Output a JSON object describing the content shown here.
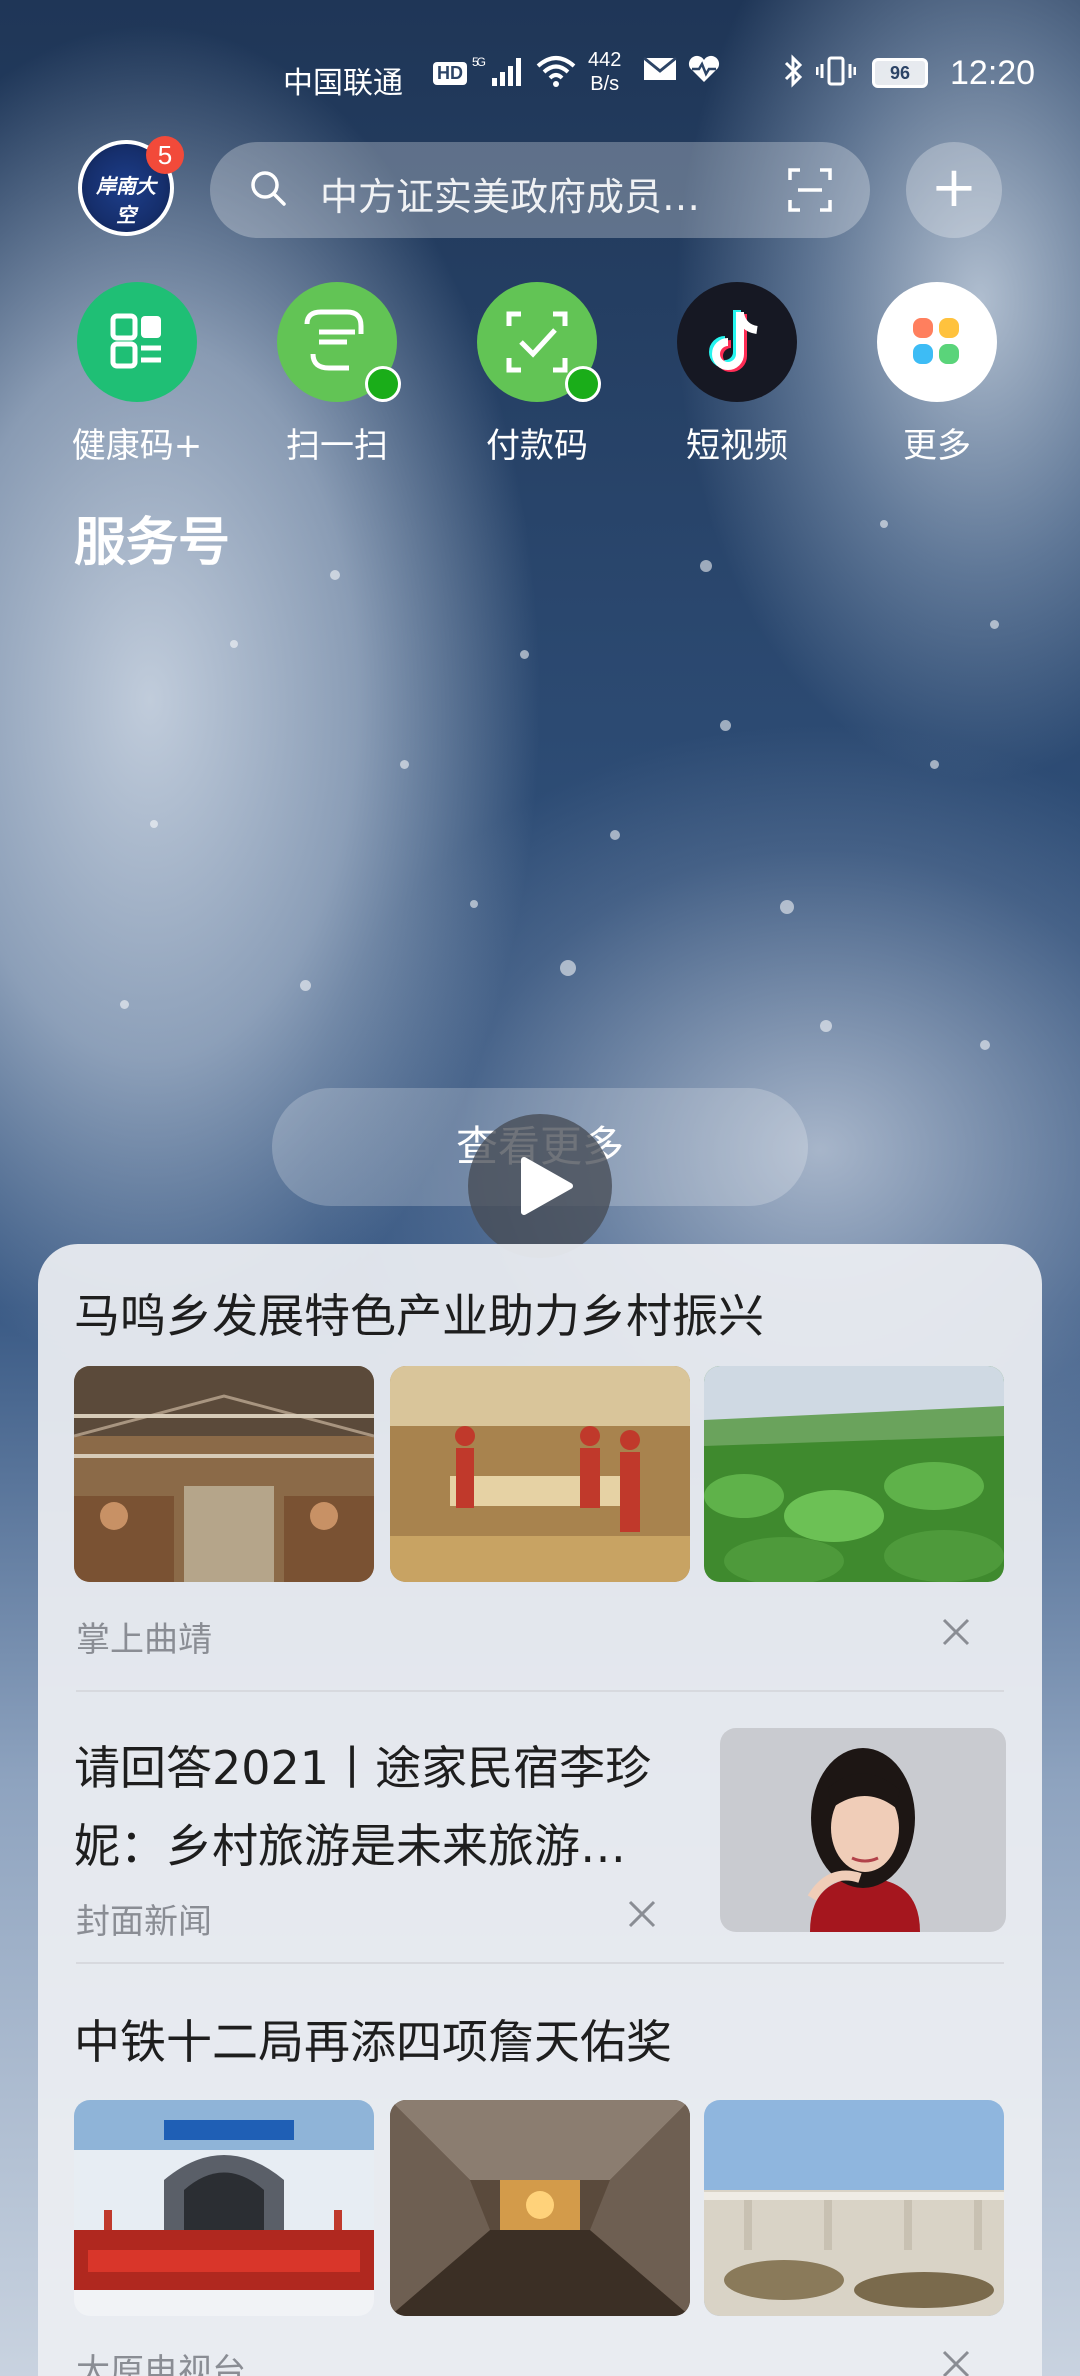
{
  "status_bar": {
    "carrier": "中国联通",
    "hd": "HD",
    "signal": "⁵ᴳ.ıl",
    "speed_value": "442",
    "speed_unit": "B/s",
    "battery": "96",
    "time": "12:20"
  },
  "header": {
    "avatar_badge": "5",
    "avatar_text": "岸南大空",
    "search_placeholder": "中方证实美政府成员…",
    "plus": "+"
  },
  "quick_apps": [
    {
      "label": "健康码+",
      "icon": "health-code-icon",
      "color": "#1fbf75"
    },
    {
      "label": "扫一扫",
      "icon": "wechat-scan-icon",
      "color": "#62c455"
    },
    {
      "label": "付款码",
      "icon": "wechat-pay-icon",
      "color": "#62c455"
    },
    {
      "label": "短视频",
      "icon": "douyin-icon",
      "color": "#161823"
    },
    {
      "label": "更多",
      "icon": "more-apps-icon",
      "color": "#ffffff"
    }
  ],
  "section_title": "服务号",
  "video": {
    "view_more": "查看更多"
  },
  "news": [
    {
      "title": "马鸣乡发展特色产业助力乡村振兴",
      "source": "掌上曲靖"
    },
    {
      "title_line1": "请回答2021丨途家民宿李珍",
      "title_line2": "妮：乡村旅游是未来旅游…",
      "source": "封面新闻"
    },
    {
      "title": "中铁十二局再添四项詹天佑奖",
      "source": "太原电视台"
    }
  ],
  "colors": {
    "badge": "#f24a3a",
    "health_green": "#1fbf75",
    "wechat_green": "#62c455",
    "douyin_dark": "#161823"
  }
}
